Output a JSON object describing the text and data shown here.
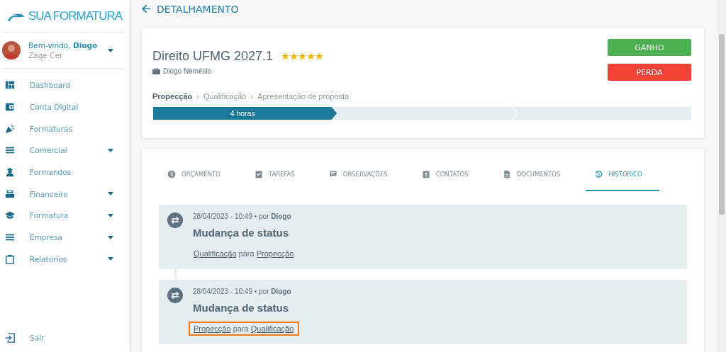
{
  "sidebar": {
    "logo": "SUA FORMATURA",
    "user": {
      "greeting": "Bem-vindo, **Diogo**",
      "company": "Zage Cer"
    },
    "items": [
      {
        "label": "Dashboard",
        "has_submenu": false
      },
      {
        "label": "Conta Digital",
        "has_submenu": false
      },
      {
        "label": "Formaturas",
        "has_submenu": false
      },
      {
        "label": "Comercial",
        "has_submenu": true
      },
      {
        "label": "Formandos",
        "has_submenu": false
      },
      {
        "label": "Financeiro",
        "has_submenu": true
      },
      {
        "label": "Formatura",
        "has_submenu": true
      },
      {
        "label": "Empresa",
        "has_submenu": true
      },
      {
        "label": "Relatórios",
        "has_submenu": true
      }
    ],
    "logout": "Sair"
  },
  "page_title": "DETALHAMENTO",
  "deal": {
    "title": "Direito UFMG 2027.1",
    "stars": 5,
    "owner": "Diogo Nemésio",
    "buttons": [
      {
        "label": "GANHO",
        "kind": "win"
      },
      {
        "label": "PERDA",
        "kind": "loss"
      }
    ],
    "breadcrumb": [
      {
        "label": "Propecção",
        "selected": true,
        "separator": "›"
      },
      {
        "label": "Qualificação",
        "selected": false,
        "separator": "›"
      },
      {
        "label": "Apresentação de proposta",
        "selected": false
      }
    ],
    "stages": [
      {
        "label": "4 horas",
        "selected": true
      },
      {
        "selected": false
      },
      {
        "selected": false
      }
    ]
  },
  "tabs": [
    {
      "label": "ORÇAMENTO",
      "selected": false
    },
    {
      "label": "TAREFAS",
      "selected": false
    },
    {
      "label": "OBSERVAÇÕES",
      "selected": false
    },
    {
      "label": "CONTATOS",
      "selected": false
    },
    {
      "label": "DOCUMENTOS",
      "selected": false
    },
    {
      "label": "HISTÓRICO",
      "selected": true
    }
  ],
  "history": [
    {
      "meta": "28/04/2023 - 10:49 • por **Diogo**",
      "title": "Mudança de status",
      "from": "Qualificação",
      "joiner": "para",
      "to": "Propecção",
      "highlighted": false
    },
    {
      "meta": "28/04/2023 - 10:49 • por **Diogo**",
      "title": "Mudança de status",
      "from": "Propecção",
      "joiner": "para",
      "to": "Qualificação",
      "highlighted": true
    }
  ]
}
